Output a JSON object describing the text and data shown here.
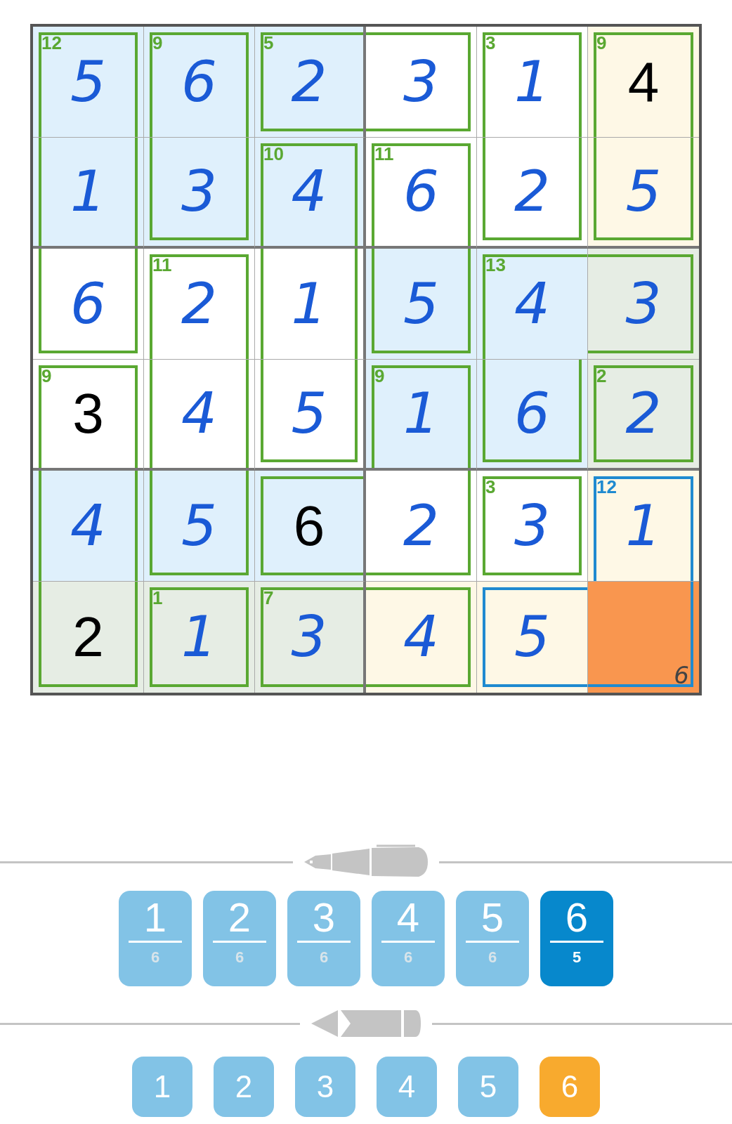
{
  "grid": {
    "rows": [
      [
        {
          "value": "5",
          "kind": "entry",
          "color": "#dff0fc",
          "selected": false,
          "cage": {
            "sum": "12",
            "top": true,
            "right": true,
            "bottom": false,
            "left": true,
            "active": false
          }
        },
        {
          "value": "6",
          "kind": "entry",
          "color": "#dff0fc",
          "selected": false,
          "cage": {
            "sum": "9",
            "top": true,
            "right": true,
            "bottom": false,
            "left": true,
            "active": false
          }
        },
        {
          "value": "2",
          "kind": "entry",
          "color": "#dff0fc",
          "selected": false,
          "cage": {
            "sum": "5",
            "top": true,
            "right": false,
            "bottom": true,
            "left": true,
            "active": false
          }
        },
        {
          "value": "3",
          "kind": "entry",
          "color": "#ffffff",
          "selected": false,
          "cage": {
            "top": true,
            "right": true,
            "bottom": true,
            "left": false,
            "active": false
          }
        },
        {
          "value": "1",
          "kind": "entry",
          "color": "#ffffff",
          "selected": false,
          "cage": {
            "sum": "3",
            "top": true,
            "right": true,
            "bottom": false,
            "left": true,
            "active": false
          }
        },
        {
          "value": "4",
          "kind": "given",
          "color": "#fef8e6",
          "selected": false,
          "cage": {
            "sum": "9",
            "top": true,
            "right": true,
            "bottom": false,
            "left": true,
            "active": false
          }
        }
      ],
      [
        {
          "value": "1",
          "kind": "entry",
          "color": "#dff0fc",
          "selected": false,
          "cage": {
            "top": false,
            "right": true,
            "bottom": false,
            "left": true,
            "active": false
          }
        },
        {
          "value": "3",
          "kind": "entry",
          "color": "#dff0fc",
          "selected": false,
          "cage": {
            "top": false,
            "right": true,
            "bottom": true,
            "left": true,
            "active": false
          }
        },
        {
          "value": "4",
          "kind": "entry",
          "color": "#dff0fc",
          "selected": false,
          "cage": {
            "sum": "10",
            "top": true,
            "right": true,
            "bottom": false,
            "left": true,
            "active": false
          }
        },
        {
          "value": "6",
          "kind": "entry",
          "color": "#ffffff",
          "selected": false,
          "cage": {
            "sum": "11",
            "top": true,
            "right": true,
            "bottom": false,
            "left": true,
            "active": false
          }
        },
        {
          "value": "2",
          "kind": "entry",
          "color": "#ffffff",
          "selected": false,
          "cage": {
            "top": false,
            "right": true,
            "bottom": true,
            "left": true,
            "active": false
          }
        },
        {
          "value": "5",
          "kind": "entry",
          "color": "#fef8e6",
          "selected": false,
          "cage": {
            "top": false,
            "right": true,
            "bottom": true,
            "left": true,
            "active": false
          }
        }
      ],
      [
        {
          "value": "6",
          "kind": "entry",
          "color": "#ffffff",
          "selected": false,
          "cage": {
            "top": false,
            "right": true,
            "bottom": true,
            "left": true,
            "active": false
          }
        },
        {
          "value": "2",
          "kind": "entry",
          "color": "#ffffff",
          "selected": false,
          "cage": {
            "sum": "11",
            "top": true,
            "right": true,
            "bottom": false,
            "left": true,
            "active": false
          }
        },
        {
          "value": "1",
          "kind": "entry",
          "color": "#ffffff",
          "selected": false,
          "cage": {
            "top": false,
            "right": true,
            "bottom": false,
            "left": true,
            "active": false
          }
        },
        {
          "value": "5",
          "kind": "entry",
          "color": "#dff0fc",
          "selected": false,
          "cage": {
            "top": false,
            "right": true,
            "bottom": true,
            "left": true,
            "active": false
          }
        },
        {
          "value": "4",
          "kind": "entry",
          "color": "#dff0fc",
          "selected": false,
          "cage": {
            "sum": "13",
            "top": true,
            "right": false,
            "bottom": false,
            "left": true,
            "active": false
          }
        },
        {
          "value": "3",
          "kind": "entry",
          "color": "#e6ede4",
          "selected": false,
          "cage": {
            "top": true,
            "right": true,
            "bottom": true,
            "left": false,
            "active": false
          }
        }
      ],
      [
        {
          "value": "3",
          "kind": "given",
          "color": "#ffffff",
          "selected": false,
          "cage": {
            "sum": "9",
            "top": true,
            "right": true,
            "bottom": false,
            "left": true,
            "active": false
          }
        },
        {
          "value": "4",
          "kind": "entry",
          "color": "#ffffff",
          "selected": false,
          "cage": {
            "top": false,
            "right": true,
            "bottom": false,
            "left": true,
            "active": false
          }
        },
        {
          "value": "5",
          "kind": "entry",
          "color": "#ffffff",
          "selected": false,
          "cage": {
            "top": false,
            "right": true,
            "bottom": true,
            "left": true,
            "active": false
          }
        },
        {
          "value": "1",
          "kind": "entry",
          "color": "#dff0fc",
          "selected": false,
          "cage": {
            "sum": "9",
            "top": true,
            "right": true,
            "bottom": false,
            "left": true,
            "active": false
          }
        },
        {
          "value": "6",
          "kind": "entry",
          "color": "#dff0fc",
          "selected": false,
          "cage": {
            "top": false,
            "right": true,
            "bottom": true,
            "left": true,
            "active": false
          }
        },
        {
          "value": "2",
          "kind": "entry",
          "color": "#e6ede4",
          "selected": false,
          "cage": {
            "sum": "2",
            "top": true,
            "right": true,
            "bottom": true,
            "left": true,
            "active": false
          }
        }
      ],
      [
        {
          "value": "4",
          "kind": "entry",
          "color": "#dff0fc",
          "selected": false,
          "cage": {
            "top": false,
            "right": true,
            "bottom": false,
            "left": true,
            "active": false
          }
        },
        {
          "value": "5",
          "kind": "entry",
          "color": "#dff0fc",
          "selected": false,
          "cage": {
            "top": false,
            "right": true,
            "bottom": true,
            "left": true,
            "active": false
          }
        },
        {
          "value": "6",
          "kind": "given",
          "color": "#dff0fc",
          "selected": false,
          "cage": {
            "top": true,
            "right": false,
            "bottom": true,
            "left": true,
            "active": false
          }
        },
        {
          "value": "2",
          "kind": "entry",
          "color": "#ffffff",
          "selected": false,
          "cage": {
            "top": false,
            "right": true,
            "bottom": true,
            "left": false,
            "active": false
          }
        },
        {
          "value": "3",
          "kind": "entry",
          "color": "#ffffff",
          "selected": false,
          "cage": {
            "sum": "3",
            "top": true,
            "right": true,
            "bottom": true,
            "left": true,
            "active": false
          }
        },
        {
          "value": "1",
          "kind": "entry",
          "color": "#fef8e6",
          "selected": false,
          "cage": {
            "sum": "12",
            "top": true,
            "right": true,
            "bottom": false,
            "left": true,
            "active": true
          }
        }
      ],
      [
        {
          "value": "2",
          "kind": "given",
          "color": "#e6ede4",
          "selected": false,
          "cage": {
            "top": false,
            "right": true,
            "bottom": true,
            "left": true,
            "active": false
          }
        },
        {
          "value": "1",
          "kind": "entry",
          "color": "#e6ede4",
          "selected": false,
          "cage": {
            "sum": "1",
            "top": true,
            "right": true,
            "bottom": true,
            "left": true,
            "active": false
          }
        },
        {
          "value": "3",
          "kind": "entry",
          "color": "#e6ede4",
          "selected": false,
          "cage": {
            "sum": "7",
            "top": true,
            "right": false,
            "bottom": true,
            "left": true,
            "active": false
          }
        },
        {
          "value": "4",
          "kind": "entry",
          "color": "#fef8e6",
          "selected": false,
          "cage": {
            "top": true,
            "right": true,
            "bottom": true,
            "left": false,
            "active": false
          }
        },
        {
          "value": "5",
          "kind": "entry",
          "color": "#fef8e6",
          "selected": false,
          "cage": {
            "top": true,
            "right": false,
            "bottom": true,
            "left": true,
            "active": true
          }
        },
        {
          "kind": "empty",
          "selected": true,
          "notes": [
            "6"
          ],
          "cage": {
            "top": false,
            "right": true,
            "bottom": true,
            "left": false,
            "active": true
          }
        }
      ]
    ]
  },
  "pen_keys": [
    {
      "digit": "1",
      "count": "6",
      "selected": false
    },
    {
      "digit": "2",
      "count": "6",
      "selected": false
    },
    {
      "digit": "3",
      "count": "6",
      "selected": false
    },
    {
      "digit": "4",
      "count": "6",
      "selected": false
    },
    {
      "digit": "5",
      "count": "6",
      "selected": false
    },
    {
      "digit": "6",
      "count": "5",
      "selected": true
    }
  ],
  "pencil_keys": [
    {
      "digit": "1",
      "selected": false
    },
    {
      "digit": "2",
      "selected": false
    },
    {
      "digit": "3",
      "selected": false
    },
    {
      "digit": "4",
      "selected": false
    },
    {
      "digit": "5",
      "selected": false
    },
    {
      "digit": "6",
      "selected": true
    }
  ]
}
